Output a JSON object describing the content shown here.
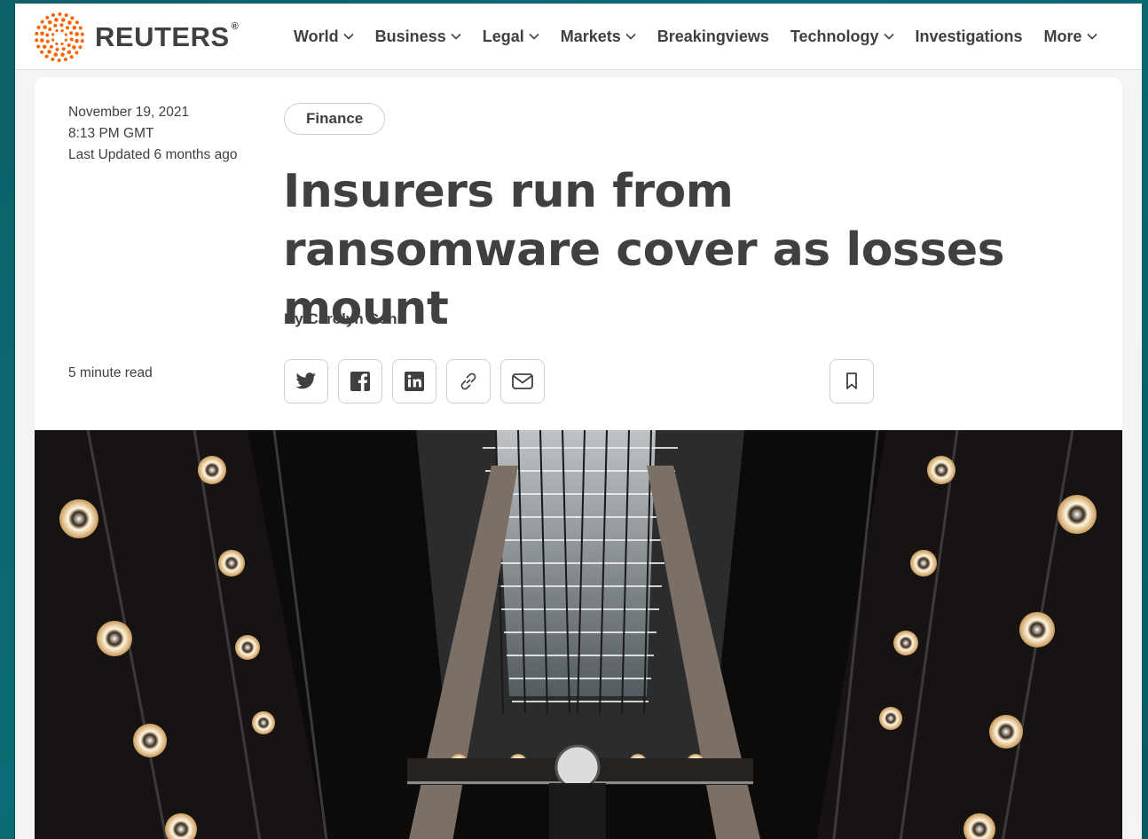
{
  "site": {
    "brand": "REUTERS",
    "brand_mark": "®"
  },
  "nav": {
    "items": [
      {
        "label": "World",
        "dropdown": true
      },
      {
        "label": "Business",
        "dropdown": true
      },
      {
        "label": "Legal",
        "dropdown": true
      },
      {
        "label": "Markets",
        "dropdown": true
      },
      {
        "label": "Breakingviews",
        "dropdown": false
      },
      {
        "label": "Technology",
        "dropdown": true
      },
      {
        "label": "Investigations",
        "dropdown": false
      },
      {
        "label": "More",
        "dropdown": true
      }
    ]
  },
  "article": {
    "date": "November 19, 2021",
    "time": "8:13 PM GMT",
    "updated": "Last Updated 6 months ago",
    "category": "Finance",
    "headline": "Insurers run from ransomware cover as losses mount",
    "byline": "By Carolyn Cohn",
    "read_time": "5 minute read"
  },
  "share": {
    "buttons": [
      "twitter-icon",
      "facebook-icon",
      "linkedin-icon",
      "link-icon",
      "email-icon"
    ]
  },
  "colors": {
    "brand_orange": "#fa6400",
    "text": "#404040",
    "border": "#cfcfcf"
  }
}
